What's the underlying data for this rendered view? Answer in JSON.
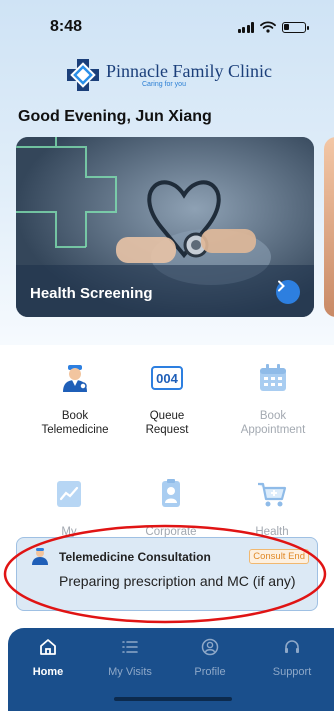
{
  "status_bar": {
    "time": "8:48",
    "icons": [
      "cellular-signal-icon",
      "wifi-icon",
      "battery-icon"
    ]
  },
  "brand": {
    "name": "Pinnacle Family Clinic",
    "tagline": "Caring for you",
    "logo_icon": "cross-diamond-logo-icon"
  },
  "greeting": "Good Evening, Jun Xiang",
  "banner": {
    "title": "Health Screening",
    "icon": "chevron-right-icon"
  },
  "services": [
    {
      "label": "Book\nTelemedicine",
      "icon": "doctor-icon",
      "enabled": true
    },
    {
      "label": "Queue\nRequest",
      "icon": "queue-number-icon",
      "enabled": true,
      "icon_text": "004"
    },
    {
      "label": "Book\nAppointment",
      "icon": "calendar-icon",
      "enabled": false
    },
    {
      "label": "My",
      "icon": "chart-icon",
      "enabled": false
    },
    {
      "label": "Corporate",
      "icon": "id-badge-icon",
      "enabled": false
    },
    {
      "label": "Health",
      "icon": "shopping-cart-icon",
      "enabled": false
    }
  ],
  "consultation": {
    "title": "Telemedicine Consultation",
    "badge": "Consult End",
    "message": "Preparing prescription and MC (if any)"
  },
  "tabs": [
    {
      "label": "Home",
      "icon": "home-icon",
      "active": true
    },
    {
      "label": "My Visits",
      "icon": "list-icon",
      "active": false
    },
    {
      "label": "Profile",
      "icon": "profile-icon",
      "active": false
    },
    {
      "label": "Support",
      "icon": "headset-icon",
      "active": false
    }
  ],
  "colors": {
    "primary": "#1a4f8c",
    "accent": "#2d7fe0",
    "badge": "#e08a28",
    "annotation": "#e01414"
  }
}
